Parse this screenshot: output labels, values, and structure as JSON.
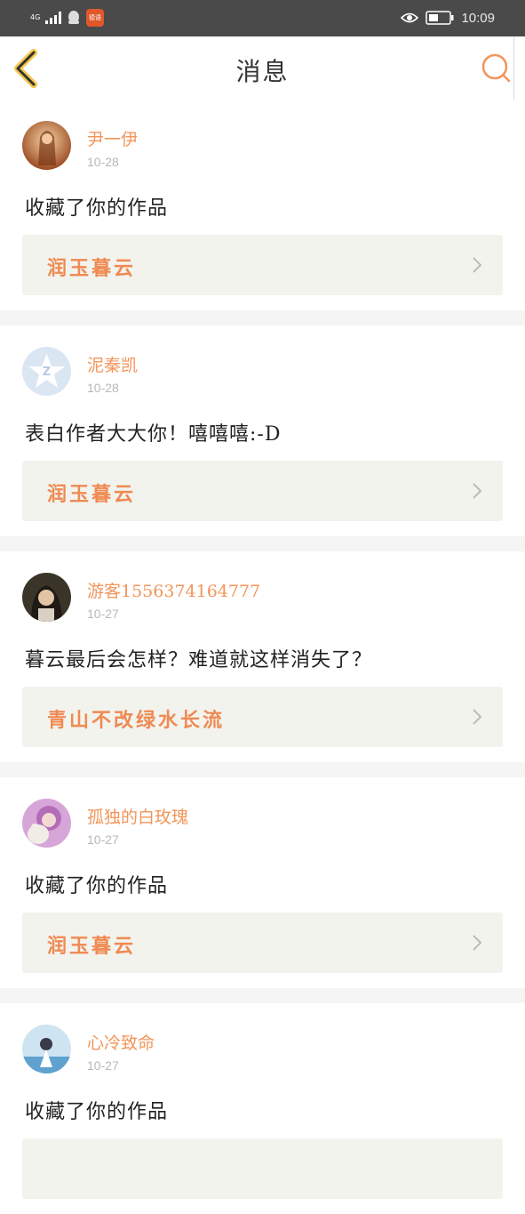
{
  "status_bar": {
    "network": "4G",
    "app_badge": "德语",
    "time": "10:09"
  },
  "header": {
    "title": "消息"
  },
  "messages": [
    {
      "user": "尹一伊",
      "date": "10-28",
      "text": "收藏了你的作品",
      "work": "润玉暮云",
      "avatar": "avatar-girl-warm"
    },
    {
      "user": "泥秦凯",
      "date": "10-28",
      "text": "表白作者大大你！嘻嘻嘻:-D",
      "work": "润玉暮云",
      "avatar": "qq-default-avatar"
    },
    {
      "user": "游客1556374164777",
      "date": "10-27",
      "text": "暮云最后会怎样？难道就这样消失了？",
      "work": "青山不改绿水长流",
      "avatar": "avatar-girl-dark"
    },
    {
      "user": "孤独的白玫瑰",
      "date": "10-27",
      "text": "收藏了你的作品",
      "work": "润玉暮云",
      "avatar": "avatar-doll-pink"
    },
    {
      "user": "心冷致命",
      "date": "10-27",
      "text": "收藏了你的作品",
      "work": "",
      "avatar": "avatar-girl-blue"
    }
  ],
  "colors": {
    "accent": "#f2955a",
    "work_title": "#ef8a52",
    "link_bg": "#f3f3ee",
    "status_bar": "#4a4a4a"
  }
}
